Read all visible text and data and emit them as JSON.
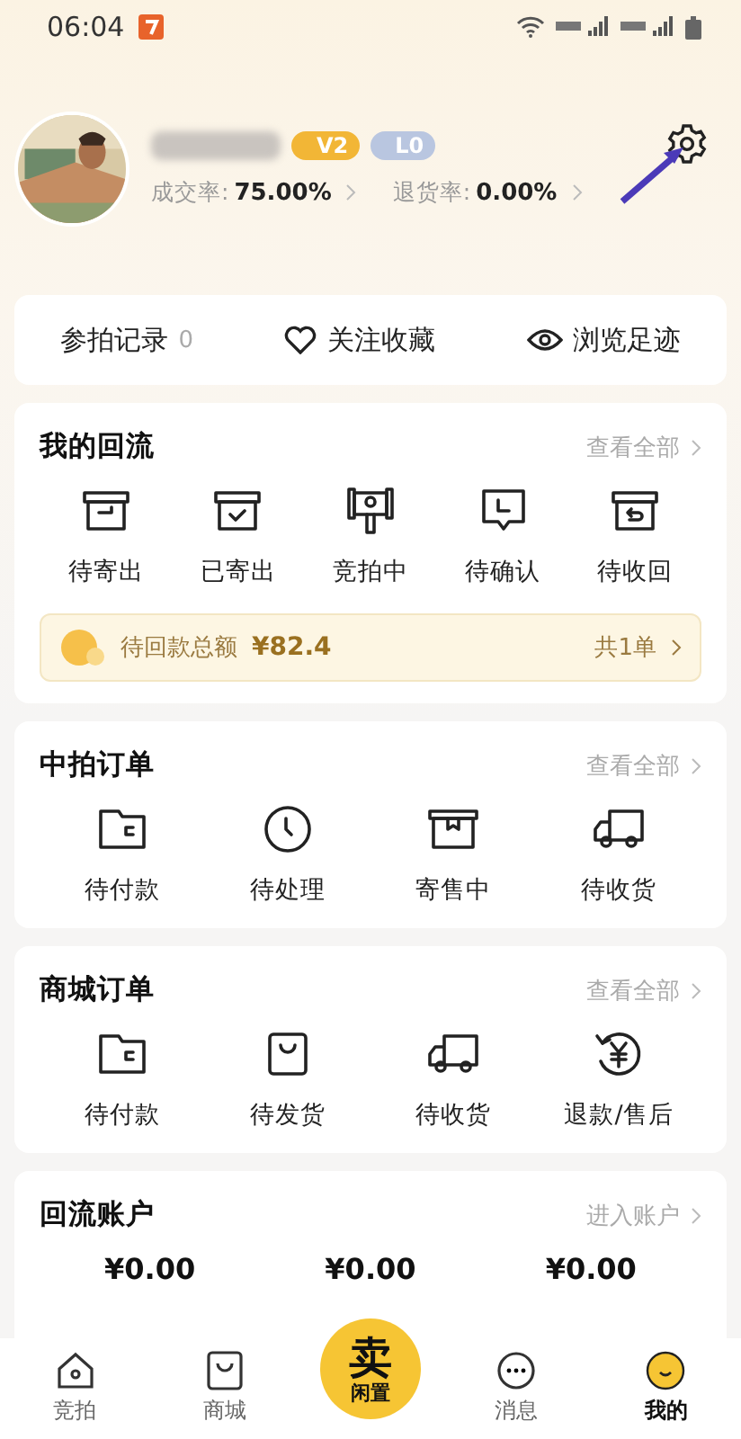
{
  "status_bar": {
    "time": "06:04"
  },
  "profile": {
    "badges": [
      {
        "label": "V2",
        "kind": "vip"
      },
      {
        "label": "L0",
        "kind": "level"
      }
    ],
    "stats": [
      {
        "label": "成交率:",
        "value": "75.00%"
      },
      {
        "label": "退货率:",
        "value": "0.00%"
      }
    ]
  },
  "quick_links": [
    {
      "label": "参拍记录",
      "count": "0"
    },
    {
      "label": "关注收藏"
    },
    {
      "label": "浏览足迹"
    }
  ],
  "sections": [
    {
      "title": "我的回流",
      "link": "查看全部",
      "items": [
        "待寄出",
        "已寄出",
        "竞拍中",
        "待确认",
        "待收回"
      ],
      "banner": {
        "label": "待回款总额",
        "amount": "¥82.4",
        "count": "共1单"
      }
    },
    {
      "title": "中拍订单",
      "link": "查看全部",
      "items": [
        "待付款",
        "待处理",
        "寄售中",
        "待收货"
      ]
    },
    {
      "title": "商城订单",
      "link": "查看全部",
      "items": [
        "待付款",
        "待发货",
        "待收货",
        "退款/售后"
      ]
    }
  ],
  "account": {
    "title": "回流账户",
    "link": "进入账户",
    "balances": [
      "¥0.00",
      "¥0.00",
      "¥0.00"
    ]
  },
  "tab_bar": {
    "tabs": [
      {
        "label": "竞拍",
        "selected": false
      },
      {
        "label": "商城",
        "selected": false
      },
      {
        "label": "消息",
        "selected": false
      },
      {
        "label": "我的",
        "selected": true
      }
    ],
    "sell_button": {
      "label": "卖",
      "sublabel": "闲置"
    }
  }
}
